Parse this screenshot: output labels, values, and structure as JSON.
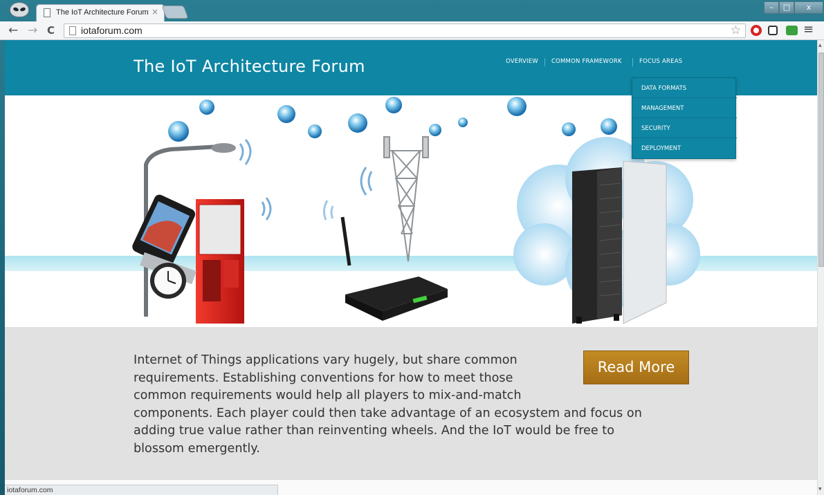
{
  "browser": {
    "tab_title": "The IoT Architecture Forum",
    "tab_close": "×",
    "url": "iotaforum.com",
    "back": "←",
    "forward": "→",
    "reload": "C",
    "star": "☆",
    "menu": "≡",
    "min": "–",
    "max": "□",
    "close": "x"
  },
  "site": {
    "title": "The IoT Architecture Forum",
    "nav": [
      "OVERVIEW",
      "COMMON FRAMEWORK",
      "FOCUS AREAS"
    ],
    "dropdown": [
      "DATA FORMATS",
      "MANAGEMENT",
      "SECURITY",
      "DEPLOYMENT"
    ],
    "blurb": "Internet of Things applications vary hugely, but share common requirements. Establishing conventions for how to meet those common requirements would help all players to mix-and-match components. Each player could then take advantage of an ecosystem and focus on adding true value rather than reinventing wheels. And the IoT would be free to blossom emergently.",
    "blurb_lines": [
      "Internet of Things applications vary hugely, but share common",
      "requirements. Establishing conventions for how to meet those",
      "common requirements would help all players to mix-and-match",
      "components. Each player could then take advantage of an ecosystem and focus on",
      "adding true value rather than reinventing wheels. And the IoT would be free to",
      "blossom emergently."
    ],
    "read_more": "Read More",
    "colors": {
      "header": "#0f86a3",
      "button": "#b07a1c",
      "content_bg": "#e1e1e1"
    }
  },
  "status_bar": "iotaforum.com"
}
